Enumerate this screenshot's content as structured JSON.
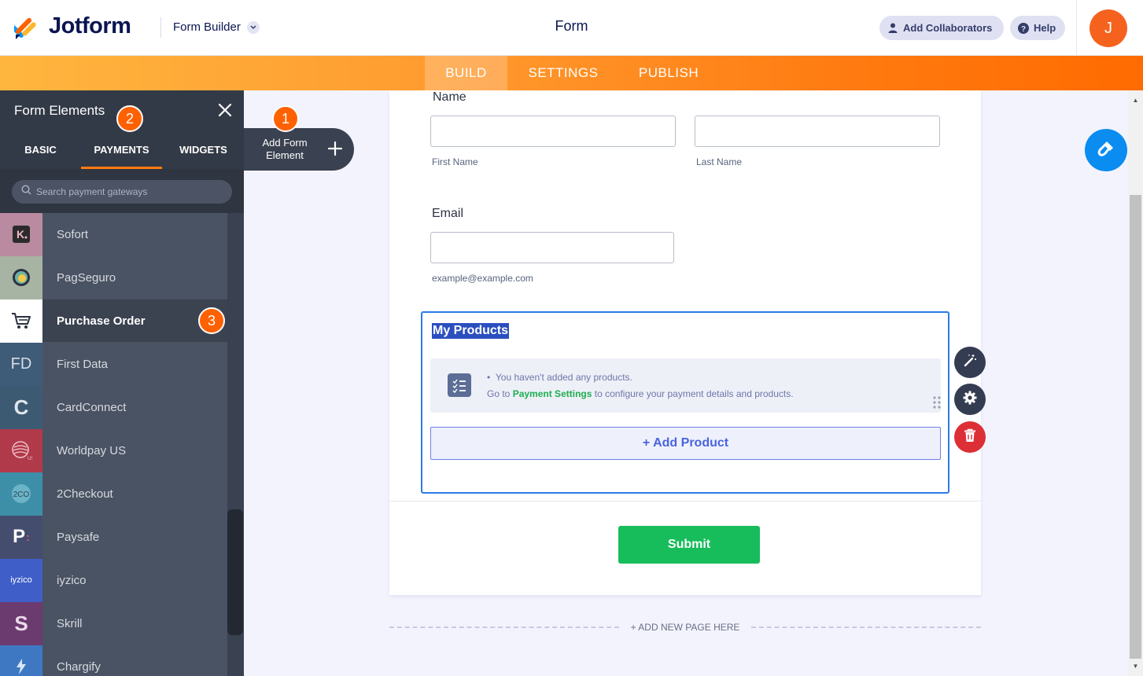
{
  "header": {
    "logo_text": "Jotform",
    "builder_label": "Form Builder",
    "form_title": "Form",
    "add_collaborators": "Add Collaborators",
    "help": "Help",
    "avatar_initial": "J"
  },
  "nav": {
    "tabs": [
      {
        "label": "BUILD",
        "active": true
      },
      {
        "label": "SETTINGS",
        "active": false
      },
      {
        "label": "PUBLISH",
        "active": false
      }
    ]
  },
  "panel": {
    "title": "Form Elements",
    "tabs": [
      {
        "label": "BASIC",
        "active": false
      },
      {
        "label": "PAYMENTS",
        "active": true
      },
      {
        "label": "WIDGETS",
        "active": false
      }
    ],
    "search_placeholder": "Search payment gateways",
    "items": [
      {
        "label": "Sofort",
        "icon": "sofort-icon",
        "active": false
      },
      {
        "label": "PagSeguro",
        "icon": "pagseguro-icon",
        "active": false
      },
      {
        "label": "Purchase Order",
        "icon": "cart-icon",
        "active": true
      },
      {
        "label": "First Data",
        "icon": "first-data-icon",
        "active": false
      },
      {
        "label": "CardConnect",
        "icon": "cardconnect-icon",
        "active": false
      },
      {
        "label": "Worldpay US",
        "icon": "worldpay-icon",
        "active": false
      },
      {
        "label": "2Checkout",
        "icon": "2checkout-icon",
        "active": false
      },
      {
        "label": "Paysafe",
        "icon": "paysafe-icon",
        "active": false
      },
      {
        "label": "iyzico",
        "icon": "iyzico-icon",
        "active": false
      },
      {
        "label": "Skrill",
        "icon": "skrill-icon",
        "active": false
      },
      {
        "label": "Chargify",
        "icon": "chargify-icon",
        "active": false
      }
    ],
    "icon_text": {
      "first_data": "FD",
      "cardconnect": "C",
      "twocheckout": "2CO",
      "paysafe": "P",
      "iyzico": "iyzico",
      "skrill": "S"
    }
  },
  "badges": {
    "one": "1",
    "two": "2",
    "three": "3"
  },
  "add_element": {
    "label": "Add Form Element"
  },
  "form": {
    "name_label": "Name",
    "first_name_sub": "First Name",
    "last_name_sub": "Last Name",
    "email_label": "Email",
    "email_sub": "example@example.com",
    "products_title": "My Products",
    "no_products": "You haven't added any products.",
    "go_to": "Go to",
    "payment_settings": "Payment Settings",
    "configure": "to configure your payment details and products.",
    "add_product": "+ Add Product",
    "submit": "Submit",
    "add_new_page": "+ ADD NEW PAGE HERE"
  },
  "colors": {
    "accent_orange": "#ff6100",
    "nav_gradient_start": "#ffb63f",
    "nav_gradient_end": "#ff6b00",
    "submit_green": "#18bd5b",
    "panel_bg": "#3a4150"
  }
}
